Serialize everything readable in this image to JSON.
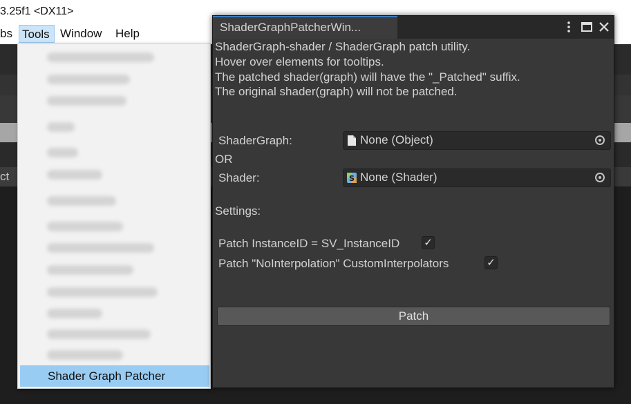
{
  "editor": {
    "title_fragment": "3.25f1 <DX11>",
    "menu": {
      "prefabs_fragment": "bs",
      "tools": "Tools",
      "window": "Window",
      "help": "Help"
    },
    "left_tab_fragment": "ct"
  },
  "tools_menu": {
    "highlighted_item": "Shader Graph Patcher"
  },
  "patcher_window": {
    "tab_title": "ShaderGraphPatcherWin...",
    "info_lines": [
      "ShaderGraph-shader / ShaderGraph patch utility.",
      "Hover over elements for tooltips.",
      "The patched shader(graph) will have the \"_Patched\" suffix.",
      "The original shader(graph) will not be patched."
    ],
    "shadergraph_label": "ShaderGraph:",
    "shadergraph_value": "None (Object)",
    "or_label": "OR",
    "shader_label": "Shader:",
    "shader_value": "None (Shader)",
    "settings_label": "Settings:",
    "setting_instanceid_label": "Patch InstanceID = SV_InstanceID",
    "setting_instanceid_checked": true,
    "setting_nointerp_label": "Patch \"NoInterpolation\" CustomInterpolators",
    "setting_nointerp_checked": true,
    "patch_button": "Patch",
    "check_glyph": "✓"
  }
}
